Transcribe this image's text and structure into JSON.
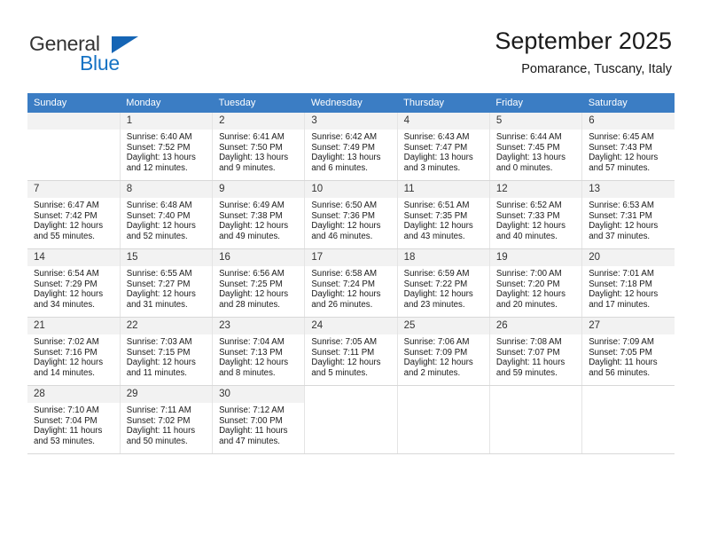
{
  "brand": {
    "name_part1": "General",
    "name_part2": "Blue",
    "accent_color": "#1673c4",
    "triangle_color": "#1565b5"
  },
  "header": {
    "title": "September 2025",
    "subtitle": "Pomarance, Tuscany, Italy"
  },
  "calendar": {
    "header_bg": "#3b7dc4",
    "header_text_color": "#ffffff",
    "daynum_bg": "#f2f2f2",
    "weekday_headers": [
      "Sunday",
      "Monday",
      "Tuesday",
      "Wednesday",
      "Thursday",
      "Friday",
      "Saturday"
    ],
    "labels": {
      "sunrise": "Sunrise:",
      "sunset": "Sunset:",
      "daylight": "Daylight:"
    },
    "weeks": [
      [
        {
          "day": "",
          "sunrise": "",
          "sunset": "",
          "daylight1": "",
          "daylight2": "",
          "empty": true
        },
        {
          "day": "1",
          "sunrise": "Sunrise: 6:40 AM",
          "sunset": "Sunset: 7:52 PM",
          "daylight1": "Daylight: 13 hours",
          "daylight2": "and 12 minutes."
        },
        {
          "day": "2",
          "sunrise": "Sunrise: 6:41 AM",
          "sunset": "Sunset: 7:50 PM",
          "daylight1": "Daylight: 13 hours",
          "daylight2": "and 9 minutes."
        },
        {
          "day": "3",
          "sunrise": "Sunrise: 6:42 AM",
          "sunset": "Sunset: 7:49 PM",
          "daylight1": "Daylight: 13 hours",
          "daylight2": "and 6 minutes."
        },
        {
          "day": "4",
          "sunrise": "Sunrise: 6:43 AM",
          "sunset": "Sunset: 7:47 PM",
          "daylight1": "Daylight: 13 hours",
          "daylight2": "and 3 minutes."
        },
        {
          "day": "5",
          "sunrise": "Sunrise: 6:44 AM",
          "sunset": "Sunset: 7:45 PM",
          "daylight1": "Daylight: 13 hours",
          "daylight2": "and 0 minutes."
        },
        {
          "day": "6",
          "sunrise": "Sunrise: 6:45 AM",
          "sunset": "Sunset: 7:43 PM",
          "daylight1": "Daylight: 12 hours",
          "daylight2": "and 57 minutes."
        }
      ],
      [
        {
          "day": "7",
          "sunrise": "Sunrise: 6:47 AM",
          "sunset": "Sunset: 7:42 PM",
          "daylight1": "Daylight: 12 hours",
          "daylight2": "and 55 minutes."
        },
        {
          "day": "8",
          "sunrise": "Sunrise: 6:48 AM",
          "sunset": "Sunset: 7:40 PM",
          "daylight1": "Daylight: 12 hours",
          "daylight2": "and 52 minutes."
        },
        {
          "day": "9",
          "sunrise": "Sunrise: 6:49 AM",
          "sunset": "Sunset: 7:38 PM",
          "daylight1": "Daylight: 12 hours",
          "daylight2": "and 49 minutes."
        },
        {
          "day": "10",
          "sunrise": "Sunrise: 6:50 AM",
          "sunset": "Sunset: 7:36 PM",
          "daylight1": "Daylight: 12 hours",
          "daylight2": "and 46 minutes."
        },
        {
          "day": "11",
          "sunrise": "Sunrise: 6:51 AM",
          "sunset": "Sunset: 7:35 PM",
          "daylight1": "Daylight: 12 hours",
          "daylight2": "and 43 minutes."
        },
        {
          "day": "12",
          "sunrise": "Sunrise: 6:52 AM",
          "sunset": "Sunset: 7:33 PM",
          "daylight1": "Daylight: 12 hours",
          "daylight2": "and 40 minutes."
        },
        {
          "day": "13",
          "sunrise": "Sunrise: 6:53 AM",
          "sunset": "Sunset: 7:31 PM",
          "daylight1": "Daylight: 12 hours",
          "daylight2": "and 37 minutes."
        }
      ],
      [
        {
          "day": "14",
          "sunrise": "Sunrise: 6:54 AM",
          "sunset": "Sunset: 7:29 PM",
          "daylight1": "Daylight: 12 hours",
          "daylight2": "and 34 minutes."
        },
        {
          "day": "15",
          "sunrise": "Sunrise: 6:55 AM",
          "sunset": "Sunset: 7:27 PM",
          "daylight1": "Daylight: 12 hours",
          "daylight2": "and 31 minutes."
        },
        {
          "day": "16",
          "sunrise": "Sunrise: 6:56 AM",
          "sunset": "Sunset: 7:25 PM",
          "daylight1": "Daylight: 12 hours",
          "daylight2": "and 28 minutes."
        },
        {
          "day": "17",
          "sunrise": "Sunrise: 6:58 AM",
          "sunset": "Sunset: 7:24 PM",
          "daylight1": "Daylight: 12 hours",
          "daylight2": "and 26 minutes."
        },
        {
          "day": "18",
          "sunrise": "Sunrise: 6:59 AM",
          "sunset": "Sunset: 7:22 PM",
          "daylight1": "Daylight: 12 hours",
          "daylight2": "and 23 minutes."
        },
        {
          "day": "19",
          "sunrise": "Sunrise: 7:00 AM",
          "sunset": "Sunset: 7:20 PM",
          "daylight1": "Daylight: 12 hours",
          "daylight2": "and 20 minutes."
        },
        {
          "day": "20",
          "sunrise": "Sunrise: 7:01 AM",
          "sunset": "Sunset: 7:18 PM",
          "daylight1": "Daylight: 12 hours",
          "daylight2": "and 17 minutes."
        }
      ],
      [
        {
          "day": "21",
          "sunrise": "Sunrise: 7:02 AM",
          "sunset": "Sunset: 7:16 PM",
          "daylight1": "Daylight: 12 hours",
          "daylight2": "and 14 minutes."
        },
        {
          "day": "22",
          "sunrise": "Sunrise: 7:03 AM",
          "sunset": "Sunset: 7:15 PM",
          "daylight1": "Daylight: 12 hours",
          "daylight2": "and 11 minutes."
        },
        {
          "day": "23",
          "sunrise": "Sunrise: 7:04 AM",
          "sunset": "Sunset: 7:13 PM",
          "daylight1": "Daylight: 12 hours",
          "daylight2": "and 8 minutes."
        },
        {
          "day": "24",
          "sunrise": "Sunrise: 7:05 AM",
          "sunset": "Sunset: 7:11 PM",
          "daylight1": "Daylight: 12 hours",
          "daylight2": "and 5 minutes."
        },
        {
          "day": "25",
          "sunrise": "Sunrise: 7:06 AM",
          "sunset": "Sunset: 7:09 PM",
          "daylight1": "Daylight: 12 hours",
          "daylight2": "and 2 minutes."
        },
        {
          "day": "26",
          "sunrise": "Sunrise: 7:08 AM",
          "sunset": "Sunset: 7:07 PM",
          "daylight1": "Daylight: 11 hours",
          "daylight2": "and 59 minutes."
        },
        {
          "day": "27",
          "sunrise": "Sunrise: 7:09 AM",
          "sunset": "Sunset: 7:05 PM",
          "daylight1": "Daylight: 11 hours",
          "daylight2": "and 56 minutes."
        }
      ],
      [
        {
          "day": "28",
          "sunrise": "Sunrise: 7:10 AM",
          "sunset": "Sunset: 7:04 PM",
          "daylight1": "Daylight: 11 hours",
          "daylight2": "and 53 minutes."
        },
        {
          "day": "29",
          "sunrise": "Sunrise: 7:11 AM",
          "sunset": "Sunset: 7:02 PM",
          "daylight1": "Daylight: 11 hours",
          "daylight2": "and 50 minutes."
        },
        {
          "day": "30",
          "sunrise": "Sunrise: 7:12 AM",
          "sunset": "Sunset: 7:00 PM",
          "daylight1": "Daylight: 11 hours",
          "daylight2": "and 47 minutes."
        },
        {
          "day": "",
          "sunrise": "",
          "sunset": "",
          "daylight1": "",
          "daylight2": "",
          "blank": true
        },
        {
          "day": "",
          "sunrise": "",
          "sunset": "",
          "daylight1": "",
          "daylight2": "",
          "blank": true
        },
        {
          "day": "",
          "sunrise": "",
          "sunset": "",
          "daylight1": "",
          "daylight2": "",
          "blank": true
        },
        {
          "day": "",
          "sunrise": "",
          "sunset": "",
          "daylight1": "",
          "daylight2": "",
          "blank": true
        }
      ]
    ]
  }
}
